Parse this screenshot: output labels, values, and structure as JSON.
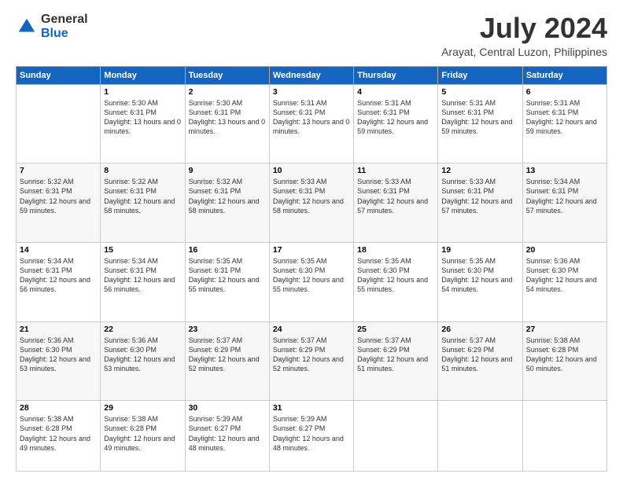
{
  "logo": {
    "general": "General",
    "blue": "Blue"
  },
  "title": "July 2024",
  "location": "Arayat, Central Luzon, Philippines",
  "days_header": [
    "Sunday",
    "Monday",
    "Tuesday",
    "Wednesday",
    "Thursday",
    "Friday",
    "Saturday"
  ],
  "weeks": [
    [
      {
        "day": "",
        "sunrise": "",
        "sunset": "",
        "daylight": ""
      },
      {
        "day": "1",
        "sunrise": "Sunrise: 5:30 AM",
        "sunset": "Sunset: 6:31 PM",
        "daylight": "Daylight: 13 hours and 0 minutes."
      },
      {
        "day": "2",
        "sunrise": "Sunrise: 5:30 AM",
        "sunset": "Sunset: 6:31 PM",
        "daylight": "Daylight: 13 hours and 0 minutes."
      },
      {
        "day": "3",
        "sunrise": "Sunrise: 5:31 AM",
        "sunset": "Sunset: 6:31 PM",
        "daylight": "Daylight: 13 hours and 0 minutes."
      },
      {
        "day": "4",
        "sunrise": "Sunrise: 5:31 AM",
        "sunset": "Sunset: 6:31 PM",
        "daylight": "Daylight: 12 hours and 59 minutes."
      },
      {
        "day": "5",
        "sunrise": "Sunrise: 5:31 AM",
        "sunset": "Sunset: 6:31 PM",
        "daylight": "Daylight: 12 hours and 59 minutes."
      },
      {
        "day": "6",
        "sunrise": "Sunrise: 5:31 AM",
        "sunset": "Sunset: 6:31 PM",
        "daylight": "Daylight: 12 hours and 59 minutes."
      }
    ],
    [
      {
        "day": "7",
        "sunrise": "Sunrise: 5:32 AM",
        "sunset": "Sunset: 6:31 PM",
        "daylight": "Daylight: 12 hours and 59 minutes."
      },
      {
        "day": "8",
        "sunrise": "Sunrise: 5:32 AM",
        "sunset": "Sunset: 6:31 PM",
        "daylight": "Daylight: 12 hours and 58 minutes."
      },
      {
        "day": "9",
        "sunrise": "Sunrise: 5:32 AM",
        "sunset": "Sunset: 6:31 PM",
        "daylight": "Daylight: 12 hours and 58 minutes."
      },
      {
        "day": "10",
        "sunrise": "Sunrise: 5:33 AM",
        "sunset": "Sunset: 6:31 PM",
        "daylight": "Daylight: 12 hours and 58 minutes."
      },
      {
        "day": "11",
        "sunrise": "Sunrise: 5:33 AM",
        "sunset": "Sunset: 6:31 PM",
        "daylight": "Daylight: 12 hours and 57 minutes."
      },
      {
        "day": "12",
        "sunrise": "Sunrise: 5:33 AM",
        "sunset": "Sunset: 6:31 PM",
        "daylight": "Daylight: 12 hours and 57 minutes."
      },
      {
        "day": "13",
        "sunrise": "Sunrise: 5:34 AM",
        "sunset": "Sunset: 6:31 PM",
        "daylight": "Daylight: 12 hours and 57 minutes."
      }
    ],
    [
      {
        "day": "14",
        "sunrise": "Sunrise: 5:34 AM",
        "sunset": "Sunset: 6:31 PM",
        "daylight": "Daylight: 12 hours and 56 minutes."
      },
      {
        "day": "15",
        "sunrise": "Sunrise: 5:34 AM",
        "sunset": "Sunset: 6:31 PM",
        "daylight": "Daylight: 12 hours and 56 minutes."
      },
      {
        "day": "16",
        "sunrise": "Sunrise: 5:35 AM",
        "sunset": "Sunset: 6:31 PM",
        "daylight": "Daylight: 12 hours and 55 minutes."
      },
      {
        "day": "17",
        "sunrise": "Sunrise: 5:35 AM",
        "sunset": "Sunset: 6:30 PM",
        "daylight": "Daylight: 12 hours and 55 minutes."
      },
      {
        "day": "18",
        "sunrise": "Sunrise: 5:35 AM",
        "sunset": "Sunset: 6:30 PM",
        "daylight": "Daylight: 12 hours and 55 minutes."
      },
      {
        "day": "19",
        "sunrise": "Sunrise: 5:35 AM",
        "sunset": "Sunset: 6:30 PM",
        "daylight": "Daylight: 12 hours and 54 minutes."
      },
      {
        "day": "20",
        "sunrise": "Sunrise: 5:36 AM",
        "sunset": "Sunset: 6:30 PM",
        "daylight": "Daylight: 12 hours and 54 minutes."
      }
    ],
    [
      {
        "day": "21",
        "sunrise": "Sunrise: 5:36 AM",
        "sunset": "Sunset: 6:30 PM",
        "daylight": "Daylight: 12 hours and 53 minutes."
      },
      {
        "day": "22",
        "sunrise": "Sunrise: 5:36 AM",
        "sunset": "Sunset: 6:30 PM",
        "daylight": "Daylight: 12 hours and 53 minutes."
      },
      {
        "day": "23",
        "sunrise": "Sunrise: 5:37 AM",
        "sunset": "Sunset: 6:29 PM",
        "daylight": "Daylight: 12 hours and 52 minutes."
      },
      {
        "day": "24",
        "sunrise": "Sunrise: 5:37 AM",
        "sunset": "Sunset: 6:29 PM",
        "daylight": "Daylight: 12 hours and 52 minutes."
      },
      {
        "day": "25",
        "sunrise": "Sunrise: 5:37 AM",
        "sunset": "Sunset: 6:29 PM",
        "daylight": "Daylight: 12 hours and 51 minutes."
      },
      {
        "day": "26",
        "sunrise": "Sunrise: 5:37 AM",
        "sunset": "Sunset: 6:29 PM",
        "daylight": "Daylight: 12 hours and 51 minutes."
      },
      {
        "day": "27",
        "sunrise": "Sunrise: 5:38 AM",
        "sunset": "Sunset: 6:28 PM",
        "daylight": "Daylight: 12 hours and 50 minutes."
      }
    ],
    [
      {
        "day": "28",
        "sunrise": "Sunrise: 5:38 AM",
        "sunset": "Sunset: 6:28 PM",
        "daylight": "Daylight: 12 hours and 49 minutes."
      },
      {
        "day": "29",
        "sunrise": "Sunrise: 5:38 AM",
        "sunset": "Sunset: 6:28 PM",
        "daylight": "Daylight: 12 hours and 49 minutes."
      },
      {
        "day": "30",
        "sunrise": "Sunrise: 5:39 AM",
        "sunset": "Sunset: 6:27 PM",
        "daylight": "Daylight: 12 hours and 48 minutes."
      },
      {
        "day": "31",
        "sunrise": "Sunrise: 5:39 AM",
        "sunset": "Sunset: 6:27 PM",
        "daylight": "Daylight: 12 hours and 48 minutes."
      },
      {
        "day": "",
        "sunrise": "",
        "sunset": "",
        "daylight": ""
      },
      {
        "day": "",
        "sunrise": "",
        "sunset": "",
        "daylight": ""
      },
      {
        "day": "",
        "sunrise": "",
        "sunset": "",
        "daylight": ""
      }
    ]
  ]
}
